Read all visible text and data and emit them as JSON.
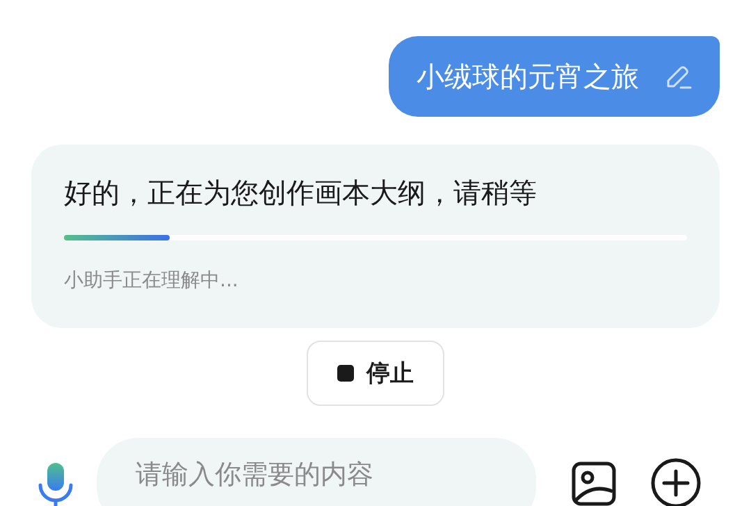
{
  "user_message": {
    "text": "小绒球的元宵之旅"
  },
  "assistant_message": {
    "text": "好的，正在为您创作画本大纲，请稍等",
    "progress": {
      "level": 0.17
    },
    "status": "小助手正在理解中..."
  },
  "stop_button": {
    "label": "停止"
  },
  "input": {
    "placeholder": "请输入你需要的内容"
  }
}
